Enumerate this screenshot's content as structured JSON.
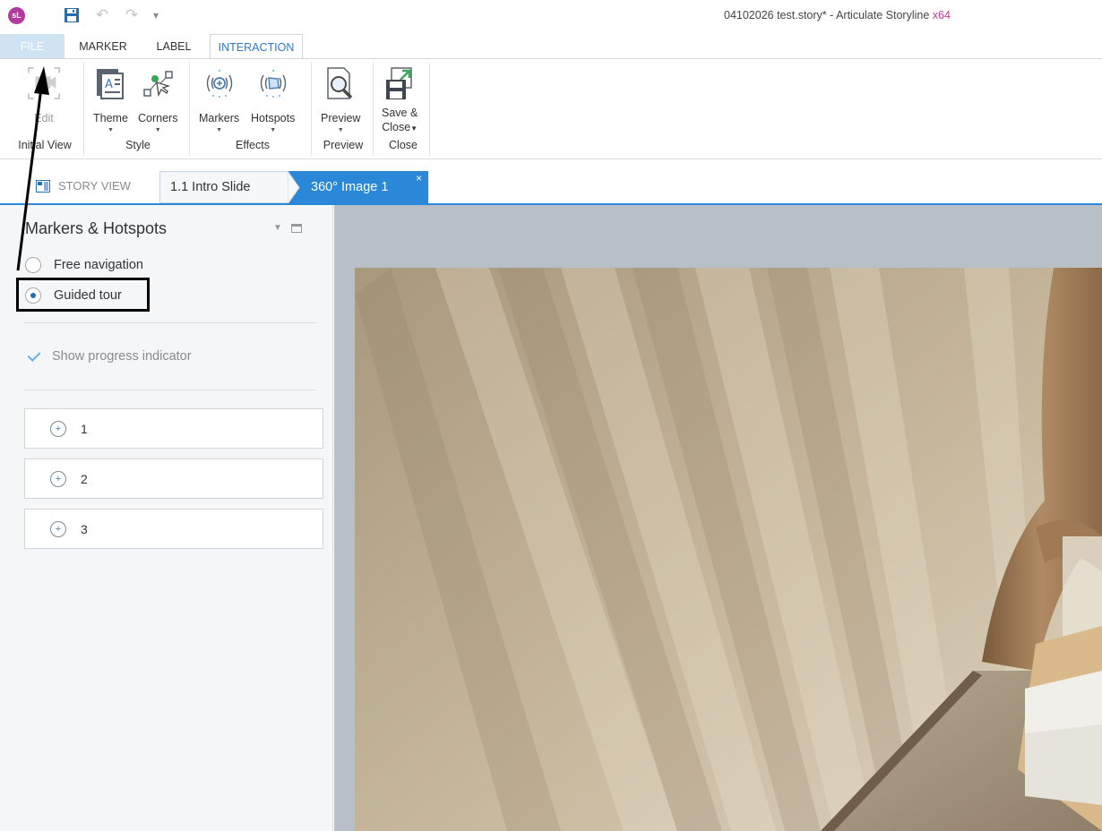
{
  "titlebar": {
    "app_logo_text": "sL",
    "window_title": "04102026 test.story* -  Articulate Storyline",
    "window_title_suffix": "x64",
    "icons": [
      "save-icon",
      "undo-icon",
      "redo-icon",
      "customize-toolbar-icon"
    ]
  },
  "ribbon_tabs": [
    "FILE",
    "MARKER",
    "LABEL",
    "INTERACTION"
  ],
  "active_ribbon_tab": "INTERACTION",
  "ribbon": {
    "buttons": {
      "edit": "Edit",
      "theme": "Theme",
      "corners": "Corners",
      "markers": "Markers",
      "hotspots": "Hotspots",
      "preview": "Preview",
      "save_close_1": "Save &",
      "save_close_2": "Close"
    },
    "groups": {
      "initial_view": "Initial View",
      "style": "Style",
      "effects": "Effects",
      "preview": "Preview",
      "close": "Close"
    }
  },
  "doc_tabs": {
    "story_view": "STORY VIEW",
    "slide": "1.1 Intro Slide",
    "current": "360° Image 1",
    "close_glyph": "×"
  },
  "panel": {
    "title": "Markers & Hotspots",
    "nav_options": [
      {
        "label": "Free navigation",
        "selected": false
      },
      {
        "label": "Guided tour",
        "selected": true
      }
    ],
    "show_progress_label": "Show progress indicator",
    "show_progress_checked": true,
    "markers": [
      "1",
      "2",
      "3"
    ]
  },
  "colors": {
    "accent": "#2b88d8",
    "brand": "#b13a9c",
    "annotation": "#000000"
  }
}
